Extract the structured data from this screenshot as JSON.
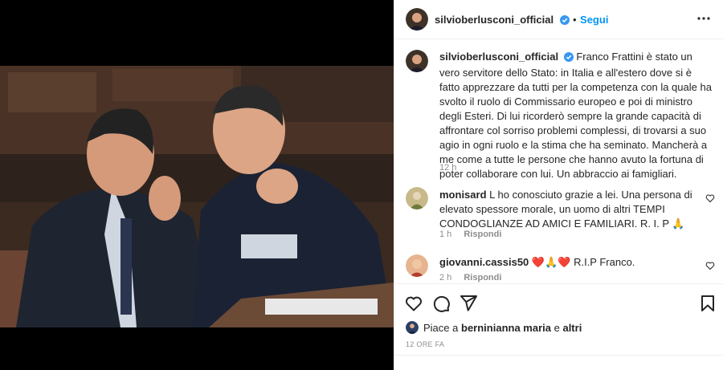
{
  "post": {
    "username": "silvioberlusconi_official",
    "follow_label": "Segui",
    "separator": "•",
    "caption": "Franco Frattini è stato un vero servitore dello Stato: in Italia e all'estero dove si è fatto apprezzare da tutti per la competenza con la quale ha svolto il ruolo di Commissario europeo e poi di ministro degli Esteri. Di lui ricorderò sempre la grande capacità di affrontare col sorriso problemi complessi, di trovarsi a suo agio in ogni ruolo e la stima che ha seminato. Mancherà a me come a tutte le persone che hanno avuto la fortuna di poter collaborare con lui. Un abbraccio ai famigliari.",
    "caption_time": "12 h"
  },
  "comments": [
    {
      "username": "monisard",
      "text": "L ho conosciuto grazie a lei. Una persona di elevato spessore morale, un uomo di altri TEMPI CONDOGLIANZE AD AMICI E FAMILIARI. R. I. P 🙏",
      "time": "1 h",
      "reply_label": "Rispondi"
    },
    {
      "username": "giovanni.cassis50",
      "text": "❤️🙏❤️ R.I.P Franco.",
      "time": "2 h",
      "reply_label": "Rispondi"
    }
  ],
  "likes": {
    "prefix": "Piace a",
    "user": "berninianna maria",
    "conj": "e",
    "others": "altri"
  },
  "date_label": "12 ORE FA",
  "icons": {
    "verified": "verified-badge-icon",
    "more": "more-options-icon",
    "like": "heart-icon",
    "comment": "comment-icon",
    "share": "share-icon",
    "save": "bookmark-icon"
  },
  "colors": {
    "link": "#0095f6",
    "verified": "#3897f0",
    "muted": "#8e8e8e",
    "text": "#262626"
  }
}
